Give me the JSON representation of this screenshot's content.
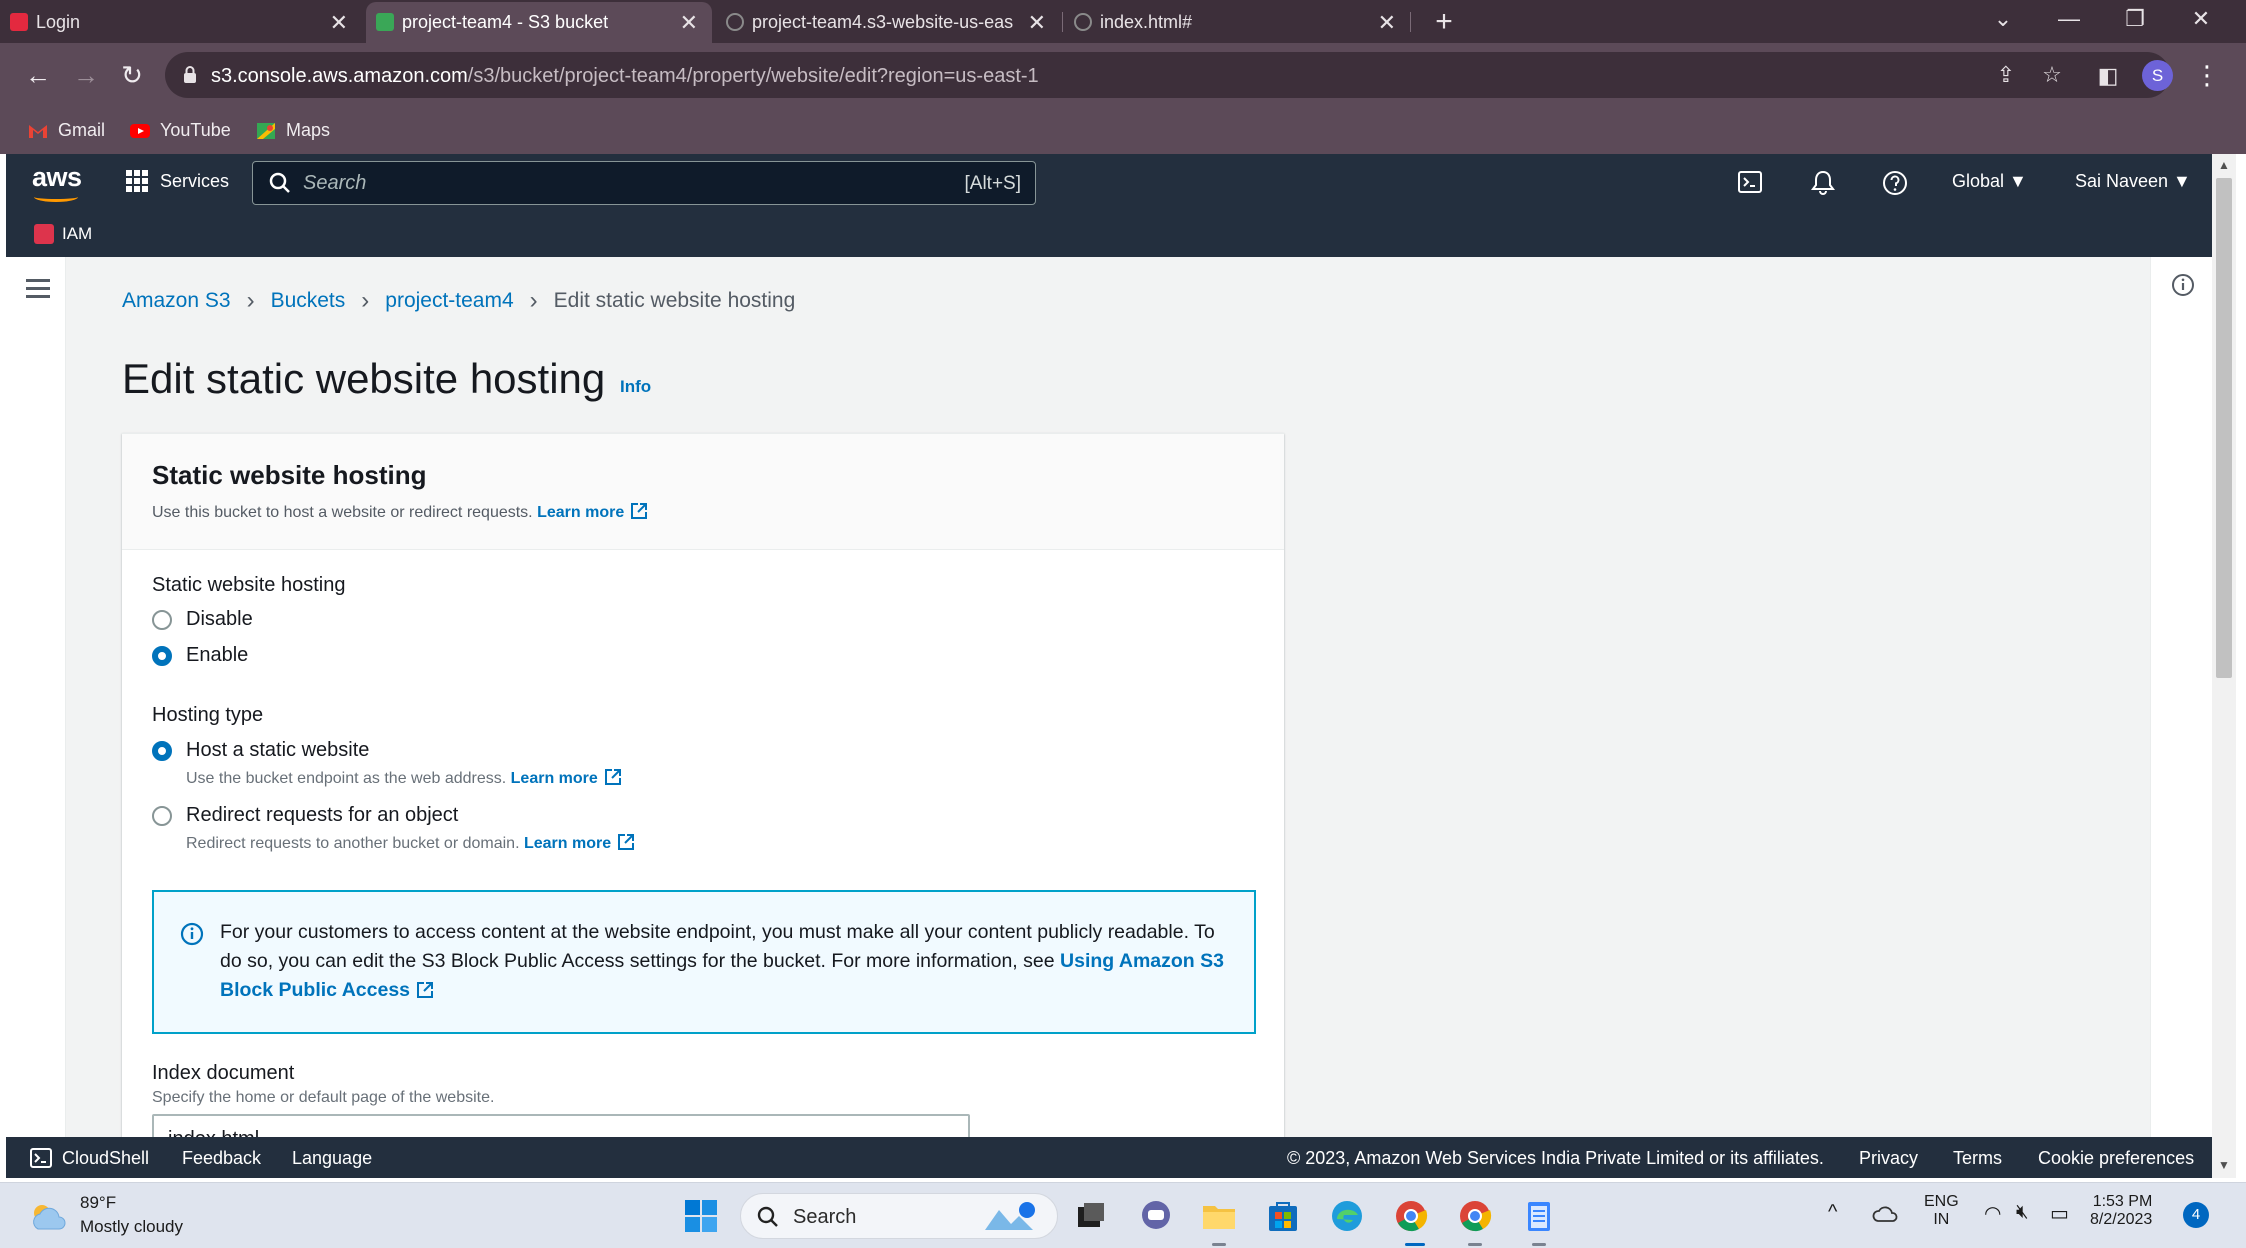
{
  "browser": {
    "tabs": [
      {
        "title": "Login",
        "favicon_color": "#e3293f"
      },
      {
        "title": "project-team4 - S3 bucket",
        "favicon_color": "#3aa757"
      },
      {
        "title": "project-team4.s3-website-us-eas",
        "favicon_color": "#8a8a8a"
      },
      {
        "title": "index.html#",
        "favicon_color": "#8a8a8a"
      }
    ],
    "url_host": "s3.console.aws.amazon.com",
    "url_path": "/s3/bucket/project-team4/property/website/edit?region=us-east-1",
    "profile_initial": "S",
    "bookmarks": [
      "Gmail",
      "YouTube",
      "Maps"
    ]
  },
  "aws_header": {
    "logo": "aws",
    "services_label": "Services",
    "search_placeholder": "Search",
    "search_shortcut": "[Alt+S]",
    "region_label": "Global ▼",
    "account_label": "Sai Naveen ▼",
    "favorites": [
      "IAM"
    ]
  },
  "breadcrumb": {
    "items": [
      "Amazon S3",
      "Buckets",
      "project-team4"
    ],
    "current": "Edit static website hosting"
  },
  "page": {
    "title": "Edit static website hosting",
    "info_label": "Info"
  },
  "panel": {
    "title": "Static website hosting",
    "description": "Use this bucket to host a website or redirect requests.",
    "learn_more": "Learn more",
    "hosting_field_label": "Static website hosting",
    "hosting_options": [
      {
        "label": "Disable",
        "selected": false
      },
      {
        "label": "Enable",
        "selected": true
      }
    ],
    "hosting_type_label": "Hosting type",
    "hosting_types": [
      {
        "label": "Host a static website",
        "sub": "Use the bucket endpoint as the web address.",
        "link": "Learn more",
        "selected": true
      },
      {
        "label": "Redirect requests for an object",
        "sub": "Redirect requests to another bucket or domain.",
        "link": "Learn more",
        "selected": false
      }
    ],
    "alert_text": "For your customers to access content at the website endpoint, you must make all your content publicly readable. To do so, you can edit the S3 Block Public Access settings for the bucket. For more information, see",
    "alert_link": "Using Amazon S3 Block Public Access",
    "index_label": "Index document",
    "index_description": "Specify the home or default page of the website.",
    "index_value": "index.html"
  },
  "footer": {
    "cloudshell": "CloudShell",
    "feedback": "Feedback",
    "language": "Language",
    "copyright": "© 2023, Amazon Web Services India Private Limited or its affiliates.",
    "privacy": "Privacy",
    "terms": "Terms",
    "cookies": "Cookie preferences"
  },
  "taskbar": {
    "weather_temp": "89°F",
    "weather_desc": "Mostly cloudy",
    "search_label": "Search",
    "lang_top": "ENG",
    "lang_bottom": "IN",
    "time": "1:53 PM",
    "date": "8/2/2023",
    "notifications": "4"
  },
  "colors": {
    "aws_nav": "#232f3e",
    "link": "#0073bb",
    "alert_border": "#00a1c9",
    "browser_frame": "#5c4a58"
  }
}
